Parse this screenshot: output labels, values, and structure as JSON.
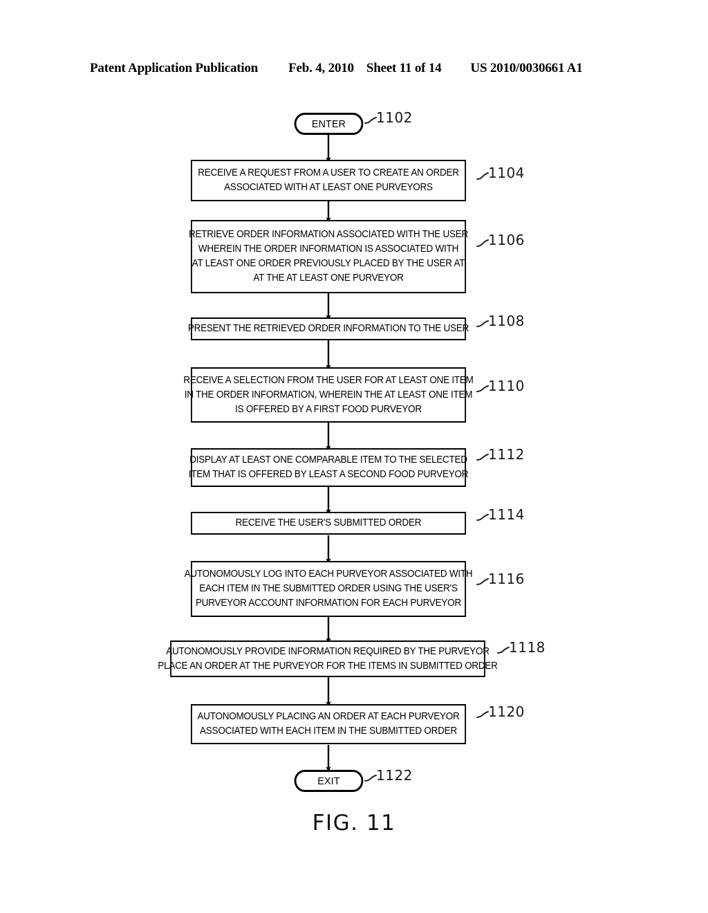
{
  "header": {
    "publication": "Patent Application Publication",
    "date": "Feb. 4, 2010",
    "sheet": "Sheet 11 of 14",
    "patent_number": "US 2010/0030661 A1"
  },
  "figure": {
    "caption": "FIG. 11",
    "type": "flowchart"
  },
  "flowchart": {
    "nodes": [
      {
        "id": "1102",
        "shape": "terminal",
        "label": "ENTER",
        "ref": "1102"
      },
      {
        "id": "1104",
        "shape": "process",
        "lines": [
          "RECEIVE A REQUEST FROM A USER TO CREATE AN ORDER",
          "ASSOCIATED WITH AT LEAST ONE PURVEYORS"
        ],
        "ref": "1104"
      },
      {
        "id": "1106",
        "shape": "process",
        "lines": [
          "RETRIEVE ORDER INFORMATION ASSOCIATED WITH THE USER",
          "WHEREIN THE ORDER INFORMATION IS ASSOCIATED WITH",
          "AT LEAST ONE ORDER PREVIOUSLY PLACED BY THE USER AT",
          "AT THE AT LEAST ONE PURVEYOR"
        ],
        "ref": "1106"
      },
      {
        "id": "1108",
        "shape": "process",
        "lines": [
          "PRESENT THE RETRIEVED ORDER INFORMATION TO THE USER"
        ],
        "ref": "1108"
      },
      {
        "id": "1110",
        "shape": "process",
        "lines": [
          "RECEIVE A SELECTION FROM THE USER FOR AT LEAST ONE ITEM",
          "IN THE ORDER INFORMATION, WHEREIN THE AT LEAST ONE ITEM",
          "IS OFFERED BY A FIRST FOOD PURVEYOR"
        ],
        "ref": "1110"
      },
      {
        "id": "1112",
        "shape": "process",
        "lines": [
          "DISPLAY AT LEAST ONE COMPARABLE ITEM TO THE SELECTED",
          "ITEM THAT IS OFFERED BY LEAST A SECOND FOOD PURVEYOR"
        ],
        "ref": "1112"
      },
      {
        "id": "1114",
        "shape": "process",
        "lines": [
          "RECEIVE THE USER'S SUBMITTED ORDER"
        ],
        "ref": "1114"
      },
      {
        "id": "1116",
        "shape": "process",
        "lines": [
          "AUTONOMOUSLY LOG INTO EACH PURVEYOR ASSOCIATED WITH",
          "EACH ITEM IN THE SUBMITTED ORDER USING THE USER'S",
          "PURVEYOR ACCOUNT INFORMATION FOR EACH PURVEYOR"
        ],
        "ref": "1116"
      },
      {
        "id": "1118",
        "shape": "process",
        "lines": [
          "AUTONOMOUSLY PROVIDE INFORMATION REQUIRED BY THE PURVEYOR",
          "PLACE AN ORDER AT THE PURVEYOR FOR THE ITEMS IN SUBMITTED ORDER"
        ],
        "ref": "1118"
      },
      {
        "id": "1120",
        "shape": "process",
        "lines": [
          "AUTONOMOUSLY PLACING AN ORDER AT EACH PURVEYOR",
          "ASSOCIATED WITH EACH ITEM IN THE SUBMITTED ORDER"
        ],
        "ref": "1120"
      },
      {
        "id": "1122",
        "shape": "terminal",
        "label": "EXIT",
        "ref": "1122"
      }
    ]
  }
}
